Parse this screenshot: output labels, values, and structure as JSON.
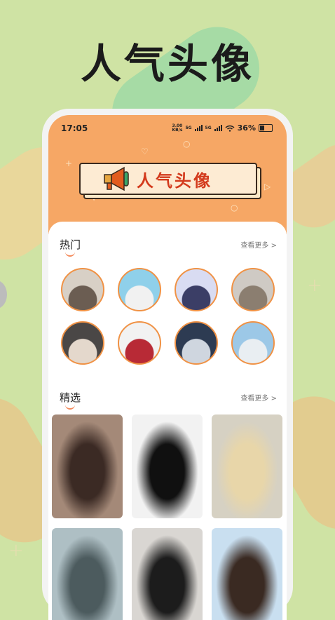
{
  "headline": "人气头像",
  "status": {
    "time": "17:05",
    "net_speed_top": "3.00",
    "net_speed_bottom": "KB/s",
    "sim1": "5G",
    "sim2": "5G",
    "battery": "36%"
  },
  "banner": {
    "title": "人气头像"
  },
  "hot": {
    "title": "热门",
    "more": "查看更多 >"
  },
  "featured": {
    "title": "精选",
    "more": "查看更多 >"
  },
  "hot_avatars": [
    {
      "colors": [
        "#d8d0c6",
        "#6b5d52"
      ]
    },
    {
      "colors": [
        "#8fd0ea",
        "#f1f1f1"
      ]
    },
    {
      "colors": [
        "#d9dcf2",
        "#3b3e66"
      ]
    },
    {
      "colors": [
        "#cfcac4",
        "#8b7e70"
      ]
    },
    {
      "colors": [
        "#4a4746",
        "#e4d8cc"
      ]
    },
    {
      "colors": [
        "#f2f2f2",
        "#b82a36"
      ]
    },
    {
      "colors": [
        "#2d3b52",
        "#cfd6df"
      ]
    },
    {
      "colors": [
        "#9cc8e7",
        "#e9eef2"
      ]
    }
  ],
  "featured_images": [
    {
      "colors": [
        "#a48978",
        "#3b2a24"
      ]
    },
    {
      "colors": [
        "#f2f2f2",
        "#101010"
      ]
    },
    {
      "colors": [
        "#d6d1c3",
        "#e8d6a9"
      ]
    },
    {
      "colors": [
        "#aebfc4",
        "#4c5b5e"
      ]
    },
    {
      "colors": [
        "#d9d6d2",
        "#1c1c1c"
      ]
    },
    {
      "colors": [
        "#c9dff0",
        "#3a2a22"
      ]
    }
  ]
}
